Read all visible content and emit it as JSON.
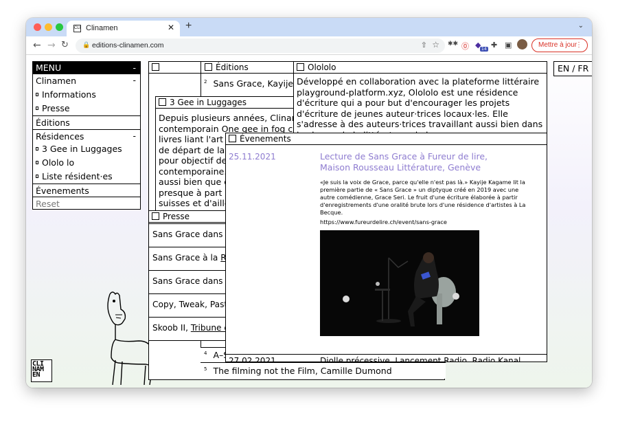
{
  "browser": {
    "tab_title": "Clinamen",
    "tab_favicon_text": "CLI",
    "url": "editions-clinamen.com",
    "update_button": "Mettre à jour",
    "extension_badge": "14"
  },
  "menu": {
    "title": "MENU",
    "collapse": "-",
    "items": [
      {
        "label": "Clinamen",
        "toggle": "-"
      },
      {
        "label": "Informations"
      },
      {
        "label": "Presse"
      },
      {
        "label": "Éditions"
      },
      {
        "label": "Résidences",
        "toggle": "-"
      },
      {
        "label": "3 Gee in Luggages"
      },
      {
        "label": "Ololo lo"
      },
      {
        "label": "Liste résident·es"
      },
      {
        "label": "Évenements"
      },
      {
        "label": "Reset"
      }
    ]
  },
  "lang": "EN / FR",
  "editions": {
    "title": "Éditions",
    "rows": [
      {
        "num": "2",
        "text": "Sans Grace, Kayije K"
      },
      {
        "num": "4",
        "text": "A–S"
      },
      {
        "num": "5",
        "text": "The filming not the Film, Camille Dumond"
      }
    ]
  },
  "ololo": {
    "title": "Olololo",
    "text": "Développé en collaboration avec la plateforme littéraire playground-platform.xyz, Olololo est une résidence d'écriture qui a pour but d'encourager les projets d'écriture de jeunes auteur·trices locaux·les. Elle s'adresse à des auteurs·trices travaillant aussi bien dans le champ de la littérature, de la"
  },
  "gee": {
    "title": "3 Gee in Luggages",
    "lines": [
      "Depuis plusieurs années, Clinamen",
      "contemporain One gee in fog cons",
      "livres liant l'art e",
      "de départ de la b",
      "pour objectif de",
      "contemporaine. V",
      "aussi bien que de",
      "presque à part é",
      "suisses et d'ailleu",
      "collection est sig"
    ]
  },
  "presse": {
    "title": "Presse",
    "rows": [
      {
        "text": "Sans Grace dans ",
        "link": "C"
      },
      {
        "text": "Sans Grace à la ",
        "link": "RT"
      },
      {
        "text": "Sans Grace dans ",
        "link": "V"
      },
      {
        "text": "Copy, Tweak, Past",
        "link": ""
      },
      {
        "text": "Skoob II, ",
        "link": "Tribune d"
      }
    ]
  },
  "events": {
    "title": "Évenements",
    "items": [
      {
        "date": "25.11.2021",
        "title": "Lecture de Sans Grace à Fureur de lire, Maison Rousseau Littérature, Genève",
        "text": "«Je suis la voix de Grace, parce qu'elle n'est pas là.» Kayije Kagame lit la première partie de « Sans Grace » un diptyque créé en 2019 avec une autre comédienne, Grace Seri. Le fruit d'une écriture élaborée à partir d'enregistrements d'une oralité brute lors d'une résidence d'artistes à La Becque.",
        "url": "https://www.fureurdelire.ch/event/sans-grace"
      },
      {
        "date": "27.02.2021",
        "title": "Diolle précessive, Lancement Radio, Radio Kanal"
      }
    ]
  },
  "logo": "CLI NAM EN"
}
